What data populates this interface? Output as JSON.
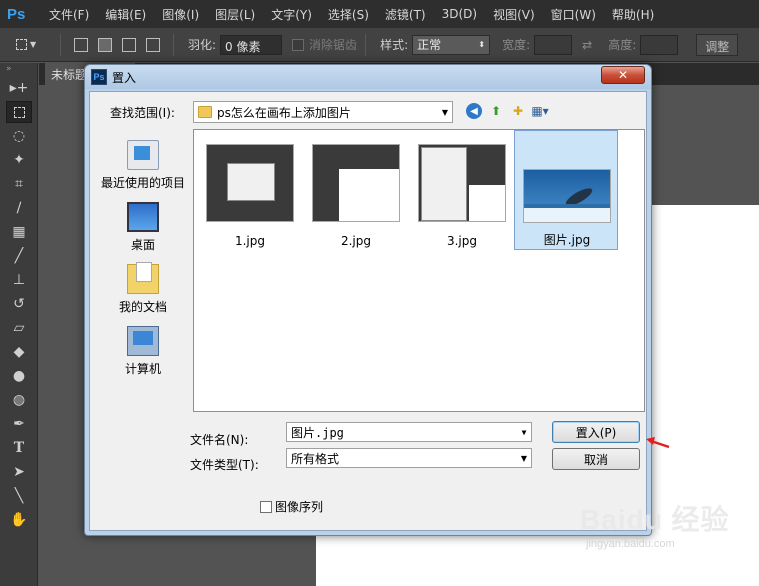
{
  "app": {
    "logo": "Ps",
    "menu": [
      "文件(F)",
      "编辑(E)",
      "图像(I)",
      "图层(L)",
      "文字(Y)",
      "选择(S)",
      "滤镜(T)",
      "3D(D)",
      "视图(V)",
      "窗口(W)",
      "帮助(H)"
    ]
  },
  "options": {
    "feather_label": "羽化:",
    "feather_value": "0 像素",
    "antialias_label": "消除锯齿",
    "style_label": "样式:",
    "style_value": "正常",
    "width_label": "宽度:",
    "height_label": "高度:",
    "adjust_label": "调整"
  },
  "document": {
    "tab_title": "未标题"
  },
  "dialog": {
    "icon": "Ps",
    "title": "置入",
    "close_label": "✕",
    "lookin_label": "查找范围(I):",
    "lookin_value": "ps怎么在画布上添加图片",
    "places": [
      {
        "label": "最近使用的项目",
        "icon": "recent-items-icon"
      },
      {
        "label": "桌面",
        "icon": "desktop-icon"
      },
      {
        "label": "我的文档",
        "icon": "my-documents-icon"
      },
      {
        "label": "计算机",
        "icon": "computer-icon"
      }
    ],
    "files": [
      {
        "name": "1.jpg",
        "selected": false
      },
      {
        "name": "2.jpg",
        "selected": false
      },
      {
        "name": "3.jpg",
        "selected": false
      },
      {
        "name": "图片.jpg",
        "selected": true
      }
    ],
    "filename_label": "文件名(N):",
    "filename_value": "图片.jpg",
    "filetype_label": "文件类型(T):",
    "filetype_value": "所有格式",
    "place_button": "置入(P)",
    "cancel_button": "取消",
    "sequence_label": "图像序列"
  },
  "watermark": {
    "brand": "Baidu 经验",
    "url": "jingyan.baidu.com"
  },
  "colors": {
    "accent": "#3c7fb1",
    "arrow": "#e02020",
    "ps_dark": "#2e2e2e"
  }
}
